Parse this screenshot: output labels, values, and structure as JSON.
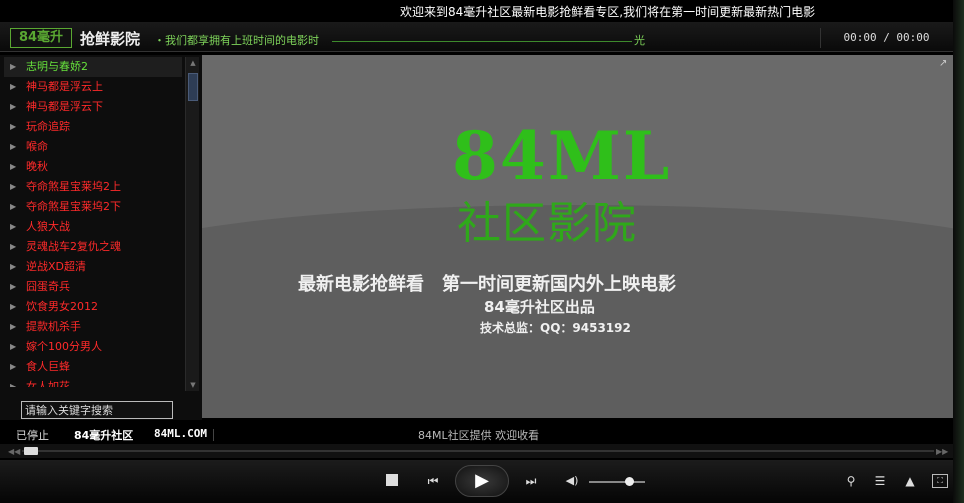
{
  "window": {
    "title": "欢迎来到84毫升社区最新电影抢鲜看专区,我们将在第一时间更新最新热门电影"
  },
  "header": {
    "logo_text": "84毫升",
    "brand": "抢鲜影院",
    "slogan": "・我们都享拥有上班时间的电影时",
    "slogan_end": "光",
    "time": "00:00 / 00:00"
  },
  "playlist": {
    "items": [
      "志明与春娇2",
      "神马都是浮云上",
      "神马都是浮云下",
      "玩命追踪",
      "喉命",
      "晚秋",
      "夺命煞星宝莱坞2上",
      "夺命煞星宝莱坞2下",
      "人狼大战",
      "灵魂战车2复仇之魂",
      "逆战XD超清",
      "囧蛋奇兵",
      "饮食男女2012",
      "提款机杀手",
      "嫁个100分男人",
      "食人巨蜂",
      "女人如花"
    ],
    "active_index": 0,
    "search_placeholder": "请输入关键字搜索"
  },
  "video": {
    "logo_main": "84ML",
    "logo_sub": "社区影院",
    "line1": "最新电影抢鲜看　第一时间更新国内外上映电影",
    "line2": "84毫升社区出品",
    "line3": "技术总监：QQ：9453192"
  },
  "status": {
    "state": "已停止",
    "site": "84毫升社区",
    "url": "84ML.COM",
    "message": "84ML社区提供 欢迎收看"
  },
  "playback": {
    "progress": 0.0,
    "volume": 0.72
  },
  "icons": {
    "stop": "stop-icon",
    "prev": "previous-icon",
    "play": "play-icon",
    "next": "next-icon",
    "volume": "volume-icon",
    "mic": "microphone-icon",
    "list": "playlist-icon",
    "skin": "shirt-icon",
    "fullscreen": "fullscreen-icon"
  }
}
